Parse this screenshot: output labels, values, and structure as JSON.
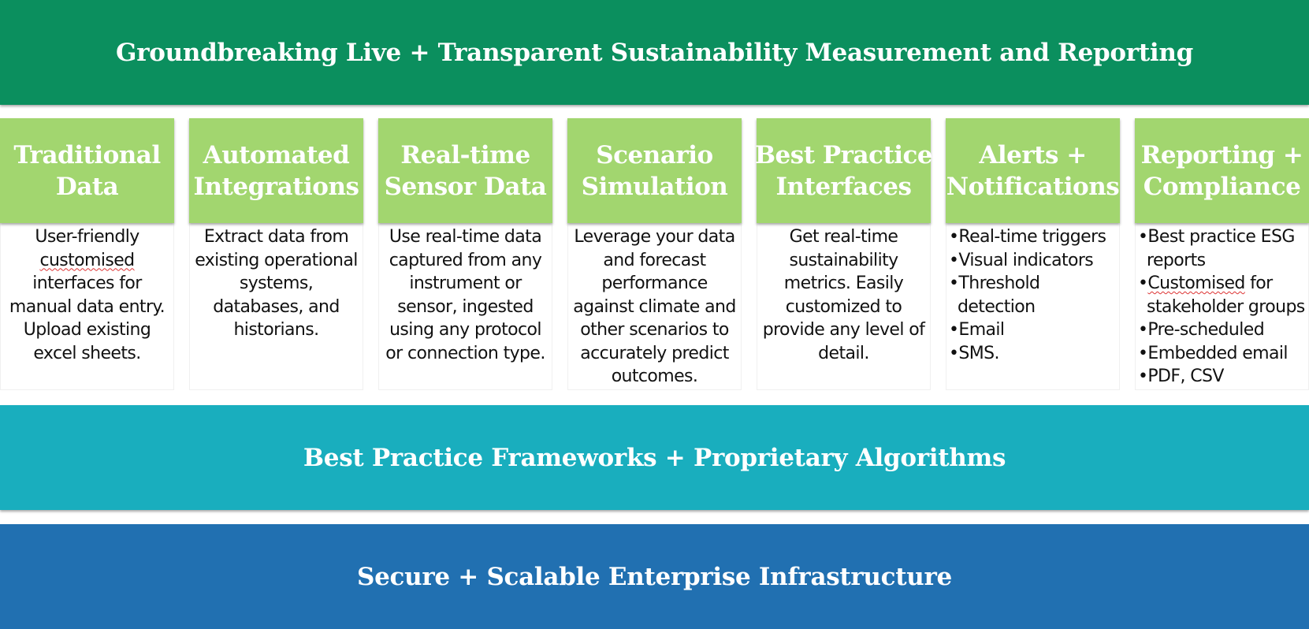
{
  "colors": {
    "top_band": "#0B8F5E",
    "column_header": "#A2D66F",
    "middle_band": "#19AEBE",
    "bottom_band": "#2170B1",
    "body_text": "#111111",
    "spellcheck_underline": "#DD3333"
  },
  "top_band": {
    "title": "Groundbreaking Live + Transparent Sustainability Measurement and Reporting"
  },
  "columns": [
    {
      "title_lines": [
        "Traditional",
        "Data"
      ],
      "type": "paragraph",
      "lines": [
        "User-friendly",
        "customised",
        "interfaces for",
        "manual data entry.",
        "Upload existing",
        "excel sheets."
      ],
      "spellcheck_flagged": [
        "customised"
      ]
    },
    {
      "title_lines": [
        "Automated",
        "Integrations"
      ],
      "type": "paragraph",
      "lines": [
        "Extract data from",
        "existing operational",
        "systems,",
        "databases, and",
        "historians."
      ]
    },
    {
      "title_lines": [
        "Real-time",
        "Sensor Data"
      ],
      "type": "paragraph",
      "lines": [
        "Use real-time data",
        "captured from any",
        "instrument or",
        "sensor, ingested",
        "using any protocol",
        "or connection type."
      ]
    },
    {
      "title_lines": [
        "Scenario",
        "Simulation"
      ],
      "type": "paragraph",
      "lines": [
        "Leverage your data",
        "and forecast",
        "performance",
        "against climate and",
        "other scenarios to",
        "accurately predict",
        "outcomes."
      ]
    },
    {
      "title_lines": [
        "Best Practice",
        "Interfaces"
      ],
      "type": "paragraph",
      "lines": [
        "Get real-time",
        "sustainability",
        "metrics. Easily",
        "customized to",
        "provide any level of",
        "detail."
      ]
    },
    {
      "title_lines": [
        "Alerts +",
        "Notifications"
      ],
      "type": "bullets",
      "bullet_char": "•",
      "items": [
        {
          "text": "Real-time triggers"
        },
        {
          "text": "Visual indicators"
        },
        {
          "text": "Threshold",
          "cont": "detection"
        },
        {
          "text": "Email"
        },
        {
          "text": "SMS."
        }
      ]
    },
    {
      "title_lines": [
        "Reporting +",
        "Compliance"
      ],
      "type": "bullets",
      "bullet_char": "•",
      "items": [
        {
          "text": "Best practice ESG",
          "cont": "reports"
        },
        {
          "flag": "Customised",
          "text": " for",
          "cont": "stakeholder groups"
        },
        {
          "text": "Pre-scheduled"
        },
        {
          "text": "Embedded email"
        },
        {
          "text": "PDF, CSV"
        }
      ]
    }
  ],
  "middle_band": {
    "title": "Best Practice Frameworks + Proprietary Algorithms"
  },
  "bottom_band": {
    "title": "Secure + Scalable Enterprise Infrastructure"
  }
}
